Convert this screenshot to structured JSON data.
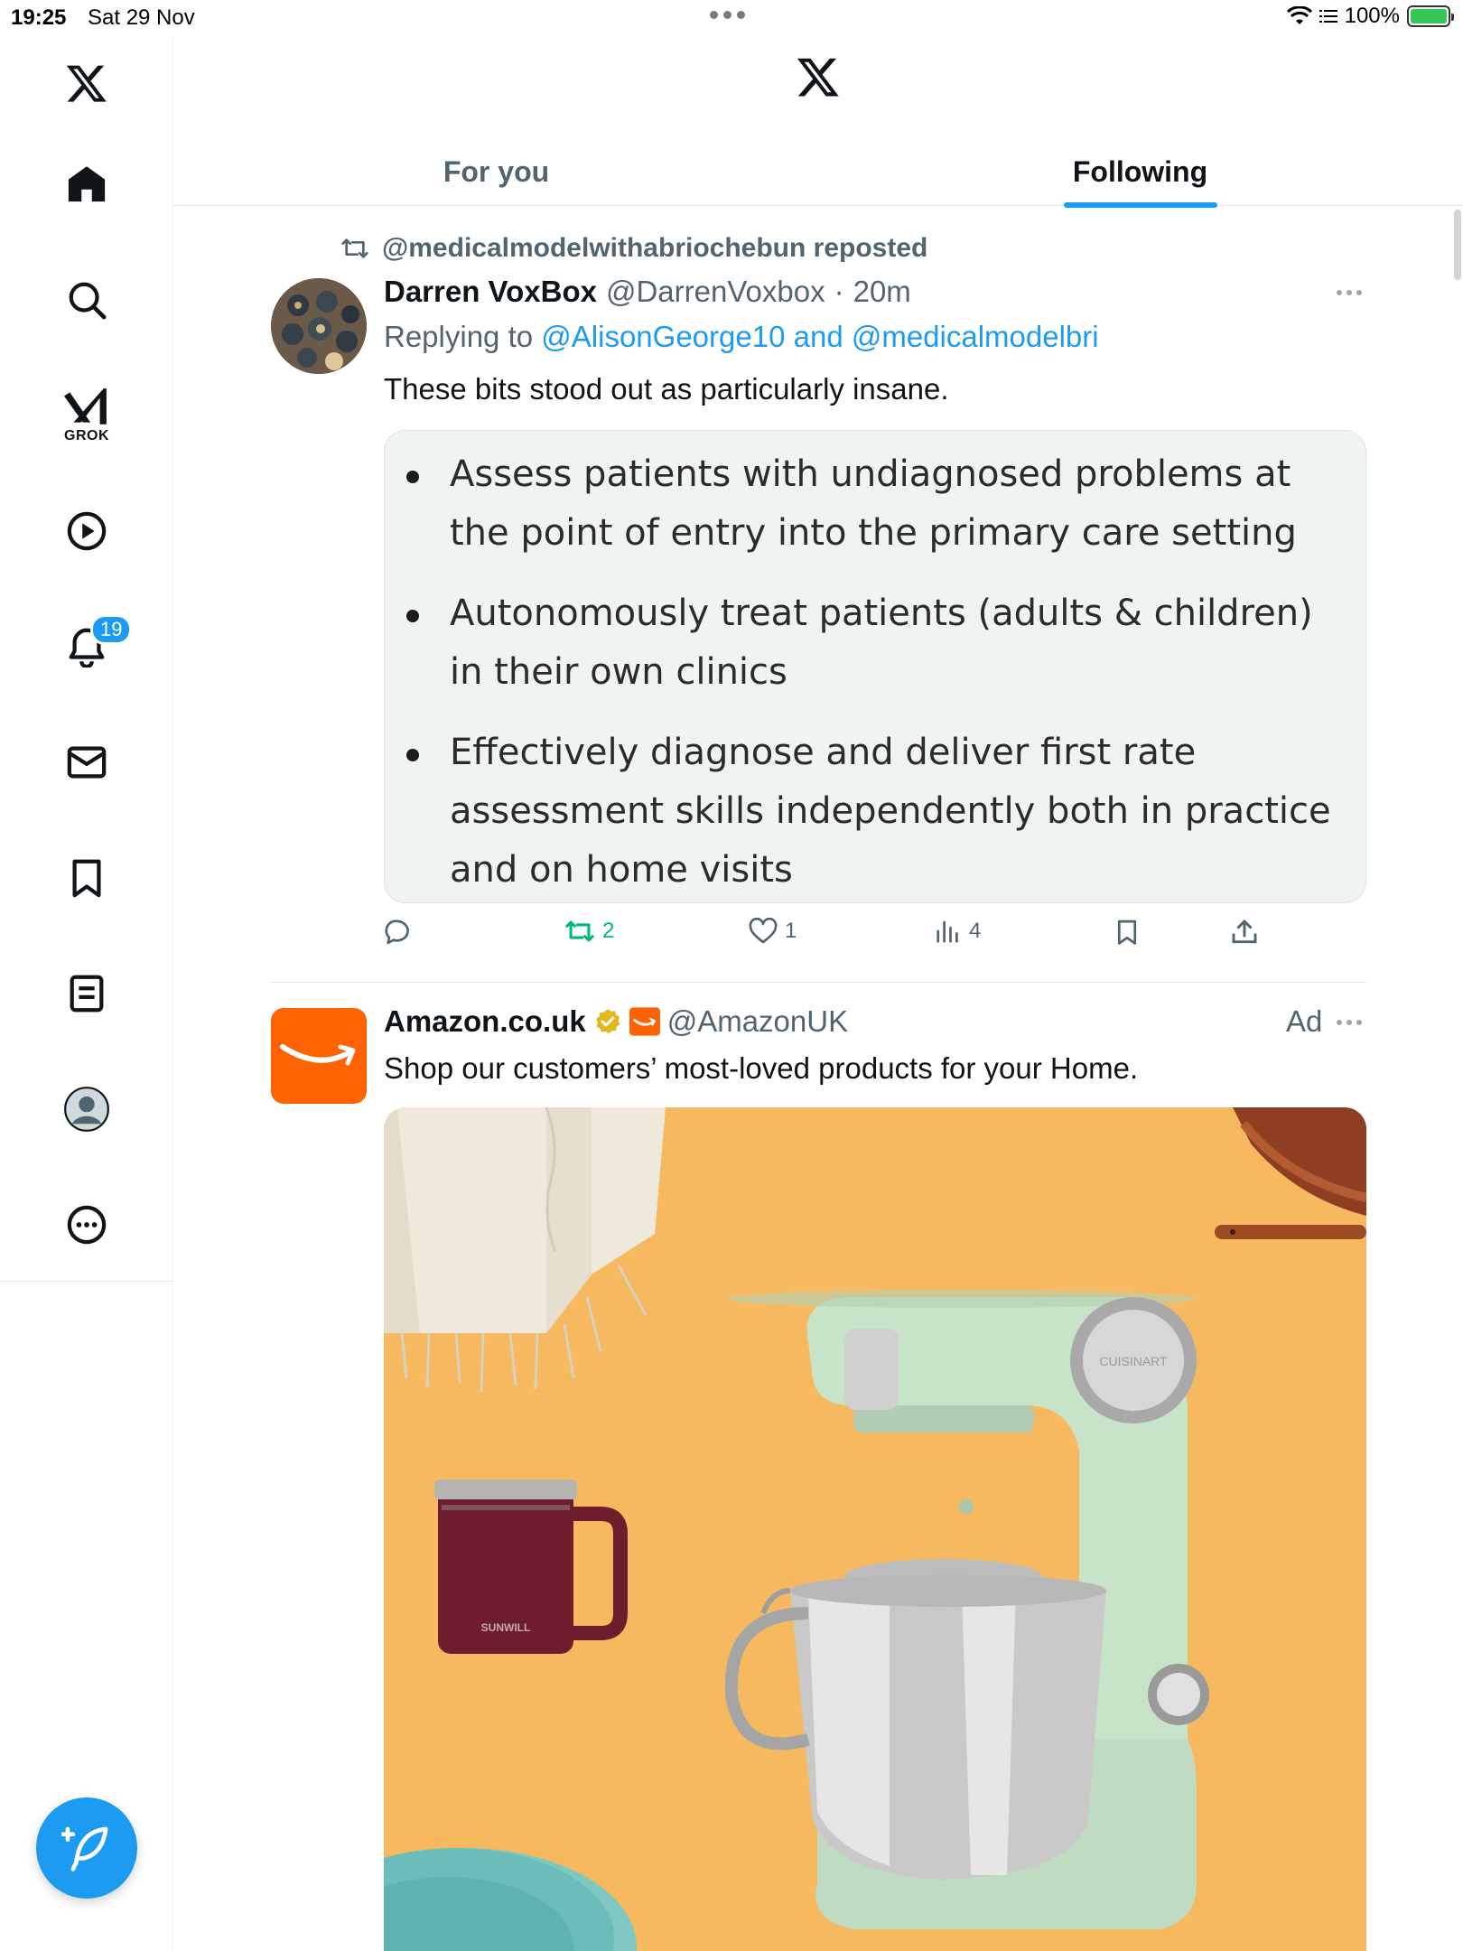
{
  "status_bar": {
    "time": "19:25",
    "date": "Sat 29 Nov",
    "battery": "100%"
  },
  "sidebar": {
    "grok_label": "GROK",
    "notification_count": "19",
    "items": [
      "home-icon",
      "search-icon",
      "grok-icon",
      "video-icon",
      "bell-icon",
      "mail-icon",
      "bookmark-icon",
      "lists-icon",
      "profile-icon",
      "more-icon"
    ]
  },
  "tabs": [
    {
      "label": "For you",
      "active": false
    },
    {
      "label": "Following",
      "active": true
    }
  ],
  "tweet1": {
    "repost_text": "@medicalmodelwithabriochebun reposted",
    "name": "Darren VoxBox",
    "handle": "@DarrenVoxbox",
    "dot": "·",
    "time": "20m",
    "replying_prefix": "Replying to",
    "replying_mention1": "@AlisonGeorge10",
    "replying_and": "and",
    "replying_mention2": "@medicalmodelbri",
    "body": "These bits stood out as particularly insane.",
    "image_bullets": [
      "Assess patients with undiagnosed problems at the point of entry into the primary care setting",
      "Autonomously treat patients (adults & children) in their own clinics",
      "Effectively diagnose and deliver first rate assessment skills independently both in practice and on home visits"
    ],
    "retweets": "2",
    "likes": "1",
    "views": "4"
  },
  "tweet2": {
    "name": "Amazon.co.uk",
    "handle": "@AmazonUK",
    "ad_label": "Ad",
    "body": "Shop our customers’ most-loved products for your Home.",
    "mug_brand": "SUNWILL",
    "mixer_brand": "CUISINART"
  },
  "colors": {
    "accent": "#1d9bf0",
    "retweet_green": "#00ba7c",
    "amazon_orange": "#ff6200",
    "text_secondary": "#536471"
  }
}
